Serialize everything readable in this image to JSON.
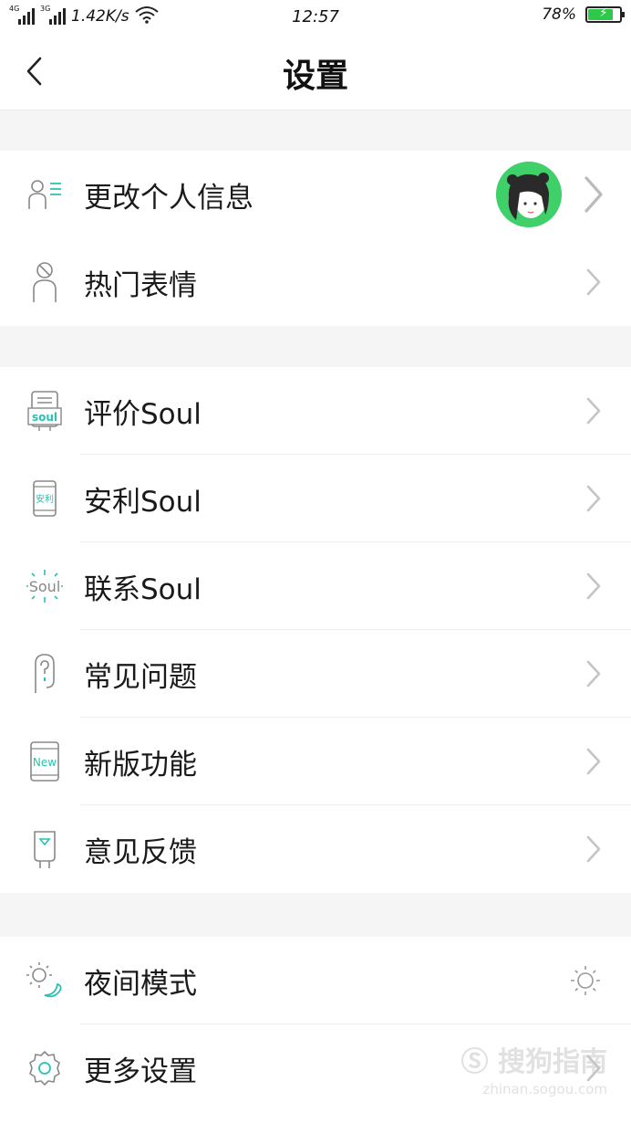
{
  "status_bar": {
    "network_1": "4G",
    "network_2": "3G",
    "speed": "1.42K/s",
    "time": "12:57",
    "battery_percent": "78%",
    "battery_level": 0.78
  },
  "header": {
    "title": "设置"
  },
  "groups": [
    {
      "items": [
        {
          "label": "更改个人信息",
          "icon": "profile-icon",
          "has_avatar": true
        },
        {
          "label": "热门表情",
          "icon": "emoji-icon"
        }
      ]
    },
    {
      "items": [
        {
          "label": "评价Soul",
          "icon": "rate-soul-icon",
          "icon_text": "soul"
        },
        {
          "label": "安利Soul",
          "icon": "share-phone-icon",
          "icon_text": "安利"
        },
        {
          "label": "联系Soul",
          "icon": "contact-soul-icon",
          "icon_text": "Soul"
        },
        {
          "label": "常见问题",
          "icon": "faq-icon"
        },
        {
          "label": "新版功能",
          "icon": "new-features-icon",
          "icon_text": "New"
        },
        {
          "label": "意见反馈",
          "icon": "feedback-icon"
        }
      ]
    },
    {
      "items": [
        {
          "label": "夜间模式",
          "icon": "night-mode-icon",
          "right_icon": "sun-icon"
        },
        {
          "label": "更多设置",
          "icon": "gear-icon"
        }
      ]
    }
  ],
  "watermark": {
    "text": "搜狗指南",
    "sub": "zhinan.sogou.com"
  },
  "colors": {
    "accent": "#27c2b2",
    "avatar_bg": "#3fd06a",
    "battery": "#2ec94a"
  }
}
